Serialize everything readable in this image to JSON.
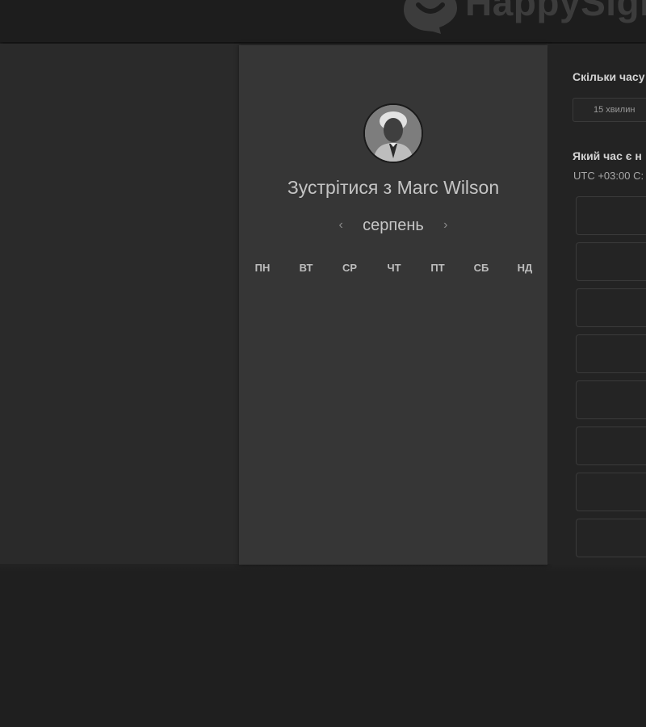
{
  "header": {
    "logo_text": "HappySign"
  },
  "calendar": {
    "title": "Зустрітися з Marc Wilson",
    "month": "серпень",
    "prev_arrow": "‹",
    "next_arrow": "›",
    "weekdays": [
      "ПН",
      "ВТ",
      "СР",
      "ЧТ",
      "ПТ",
      "СБ",
      "НД"
    ]
  },
  "booking": {
    "duration_heading": "Скільки часу",
    "duration_value": "15 хвилин",
    "time_heading": "Який час є н",
    "timezone": "UTC +03:00 С:"
  },
  "colors": {
    "background": "#1f1f1f",
    "card": "#363636",
    "panel": "#232323"
  }
}
